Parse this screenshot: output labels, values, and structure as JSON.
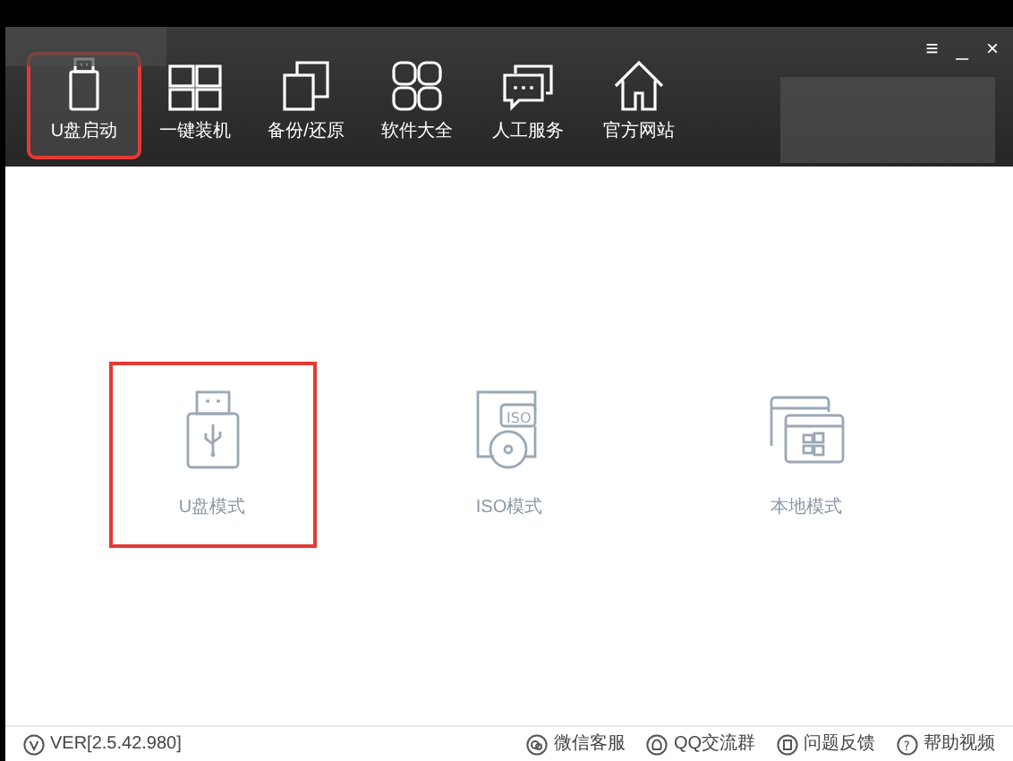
{
  "window_controls": [
    "≡",
    "_",
    "×"
  ],
  "nav": [
    {
      "label": "U盘启动",
      "kind": "usb",
      "selected": true
    },
    {
      "label": "一键装机",
      "kind": "windows",
      "selected": false
    },
    {
      "label": "备份/还原",
      "kind": "copy",
      "selected": false
    },
    {
      "label": "软件大全",
      "kind": "grid",
      "selected": false
    },
    {
      "label": "人工服务",
      "kind": "chat",
      "selected": false
    },
    {
      "label": "官方网站",
      "kind": "home",
      "selected": false
    }
  ],
  "modes": [
    {
      "label": "U盘模式",
      "kind": "usb",
      "highlighted": true
    },
    {
      "label": "ISO模式",
      "kind": "iso",
      "badge": "ISO",
      "highlighted": false
    },
    {
      "label": "本地模式",
      "kind": "local",
      "highlighted": false
    }
  ],
  "status_bar": {
    "version": "VER[2.5.42.980]",
    "links": [
      {
        "label": "微信客服",
        "kind": "wechat"
      },
      {
        "label": "QQ交流群",
        "kind": "qq"
      },
      {
        "label": "问题反馈",
        "kind": "feedback"
      },
      {
        "label": "帮助视频",
        "kind": "help",
        "icon_glyph": "?"
      }
    ]
  }
}
